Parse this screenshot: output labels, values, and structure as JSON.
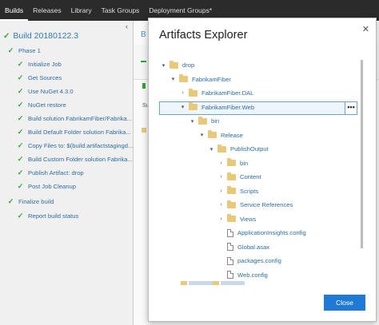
{
  "topbar": {
    "tabs": [
      "Builds",
      "Releases",
      "Library",
      "Task Groups",
      "Deployment Groups*"
    ]
  },
  "build": {
    "title": "Build 20180122.3",
    "phase": "Phase 1",
    "steps": [
      "Initialize Job",
      "Get Sources",
      "Use NuGet 4.3.0",
      "NuGet restore",
      "Build solution FabrikamFiber/Fabrika...",
      "Build Default Folder solution Fabrika...",
      "Copy Files to: $(build.artifactstagingd...",
      "Build Custom Folder solution Fabrika...",
      "Publish Artifact: drop",
      "Post Job Cleanup"
    ],
    "finalize": "Finalize build",
    "report": "Report build status"
  },
  "background": {
    "frag_b": "B",
    "frag_s": "Su"
  },
  "dialog": {
    "title": "Artifacts Explorer",
    "close_label": "Close",
    "more_label": "•••",
    "tree": [
      {
        "label": "drop",
        "type": "folder",
        "expanded": true,
        "depth": 0
      },
      {
        "label": "FabrikamFiber",
        "type": "folder",
        "expanded": true,
        "depth": 1
      },
      {
        "label": "FabrikamFiber.DAL",
        "type": "folder",
        "expanded": false,
        "depth": 2
      },
      {
        "label": "FabrikamFiber.Web",
        "type": "folder",
        "expanded": true,
        "depth": 2
      },
      {
        "label": "bin",
        "type": "folder",
        "expanded": true,
        "depth": 3
      },
      {
        "label": "Release",
        "type": "folder",
        "expanded": true,
        "depth": 4,
        "selected": true
      },
      {
        "label": "PublishOutput",
        "type": "folder",
        "expanded": true,
        "depth": 5
      },
      {
        "label": "bin",
        "type": "folder",
        "expanded": false,
        "depth": 6
      },
      {
        "label": "Content",
        "type": "folder",
        "expanded": false,
        "depth": 6
      },
      {
        "label": "Scripts",
        "type": "folder",
        "expanded": false,
        "depth": 6
      },
      {
        "label": "Service References",
        "type": "folder",
        "expanded": false,
        "depth": 6
      },
      {
        "label": "Views",
        "type": "folder",
        "expanded": false,
        "depth": 6
      },
      {
        "label": "ApplicationInsights.config",
        "type": "file",
        "depth": 6
      },
      {
        "label": "Global.asax",
        "type": "file",
        "depth": 6
      },
      {
        "label": "packages.config",
        "type": "file",
        "depth": 6
      },
      {
        "label": "Web.config",
        "type": "file",
        "depth": 6
      }
    ]
  },
  "colors": {
    "accent": "#1e7ad6",
    "success": "#36a336",
    "folder": "#e8c97a",
    "link": "#2e6da4",
    "topbar": "#2b2b2b"
  }
}
